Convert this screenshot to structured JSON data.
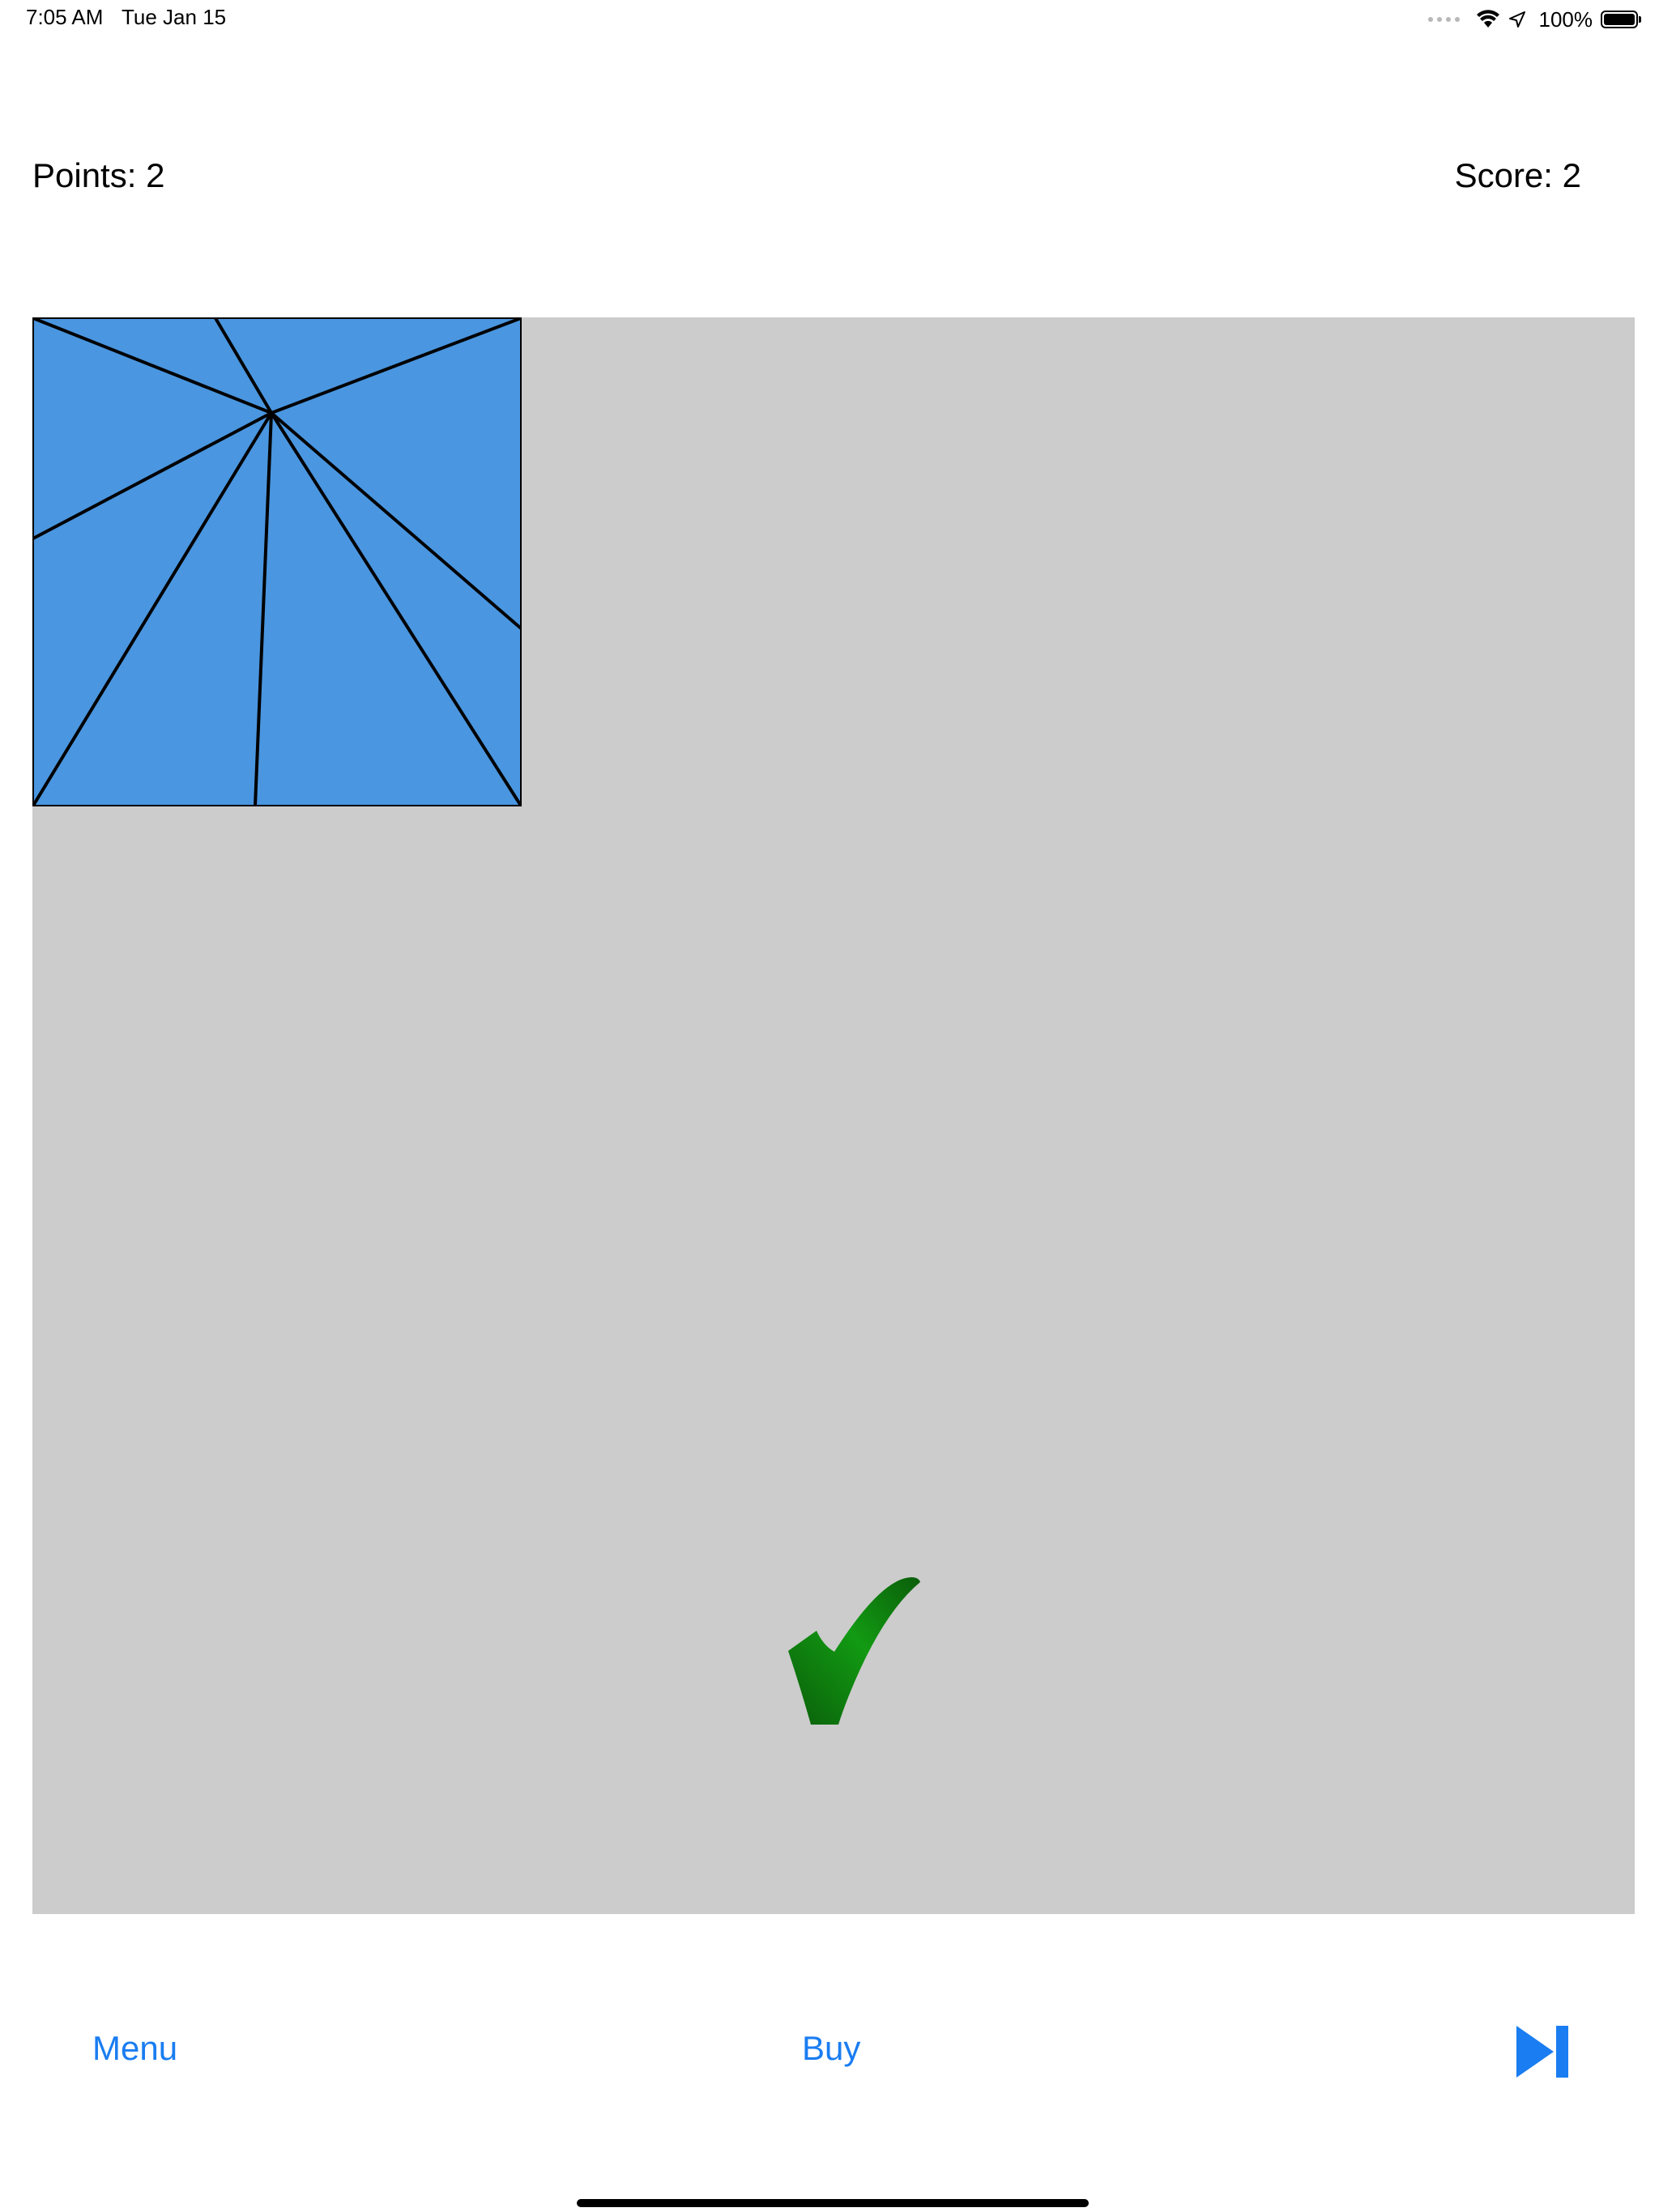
{
  "status_bar": {
    "time": "7:05 AM",
    "date": "Tue Jan 15",
    "battery": "100%",
    "icons": [
      "cellular-dots-icon",
      "wifi-icon",
      "location-arrow-icon",
      "battery-icon"
    ]
  },
  "header": {
    "points": "Points:  2",
    "score": "Score:  2"
  },
  "board": {
    "background": "#cccccc",
    "piece_color": "#4a96e0",
    "check_color": "#0f8a0f"
  },
  "footer": {
    "menu_label": "Menu",
    "buy_label": "Buy",
    "next_icon": "skip-forward-icon",
    "accent": "#1a7df1"
  }
}
